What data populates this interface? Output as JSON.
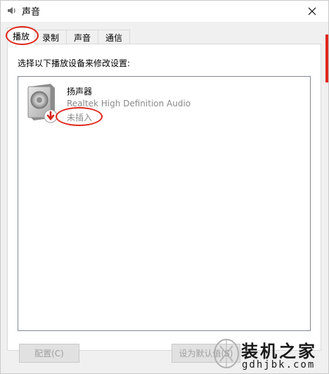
{
  "window": {
    "title": "声音",
    "close_icon": "close-icon",
    "app_icon": "speaker-icon"
  },
  "tabs": [
    {
      "label": "播放",
      "active": true
    },
    {
      "label": "录制",
      "active": false
    },
    {
      "label": "声音",
      "active": false
    },
    {
      "label": "通信",
      "active": false
    }
  ],
  "panel": {
    "instruction": "选择以下播放设备来修改设置:",
    "devices": [
      {
        "name": "扬声器",
        "description": "Realtek High Definition Audio",
        "status": "未插入",
        "icon": "speaker-icon",
        "status_icon": "down-arrow-icon"
      }
    ]
  },
  "buttons": {
    "configure": "配置(C)",
    "set_default": "设为默认值(S)"
  },
  "watermark": {
    "title": "装机之家",
    "url": "gdhjbk.com"
  },
  "colors": {
    "annotation_red": "#e0261a",
    "disabled_text": "#a0a0a0",
    "panel_bg": "#f0f0f0"
  }
}
